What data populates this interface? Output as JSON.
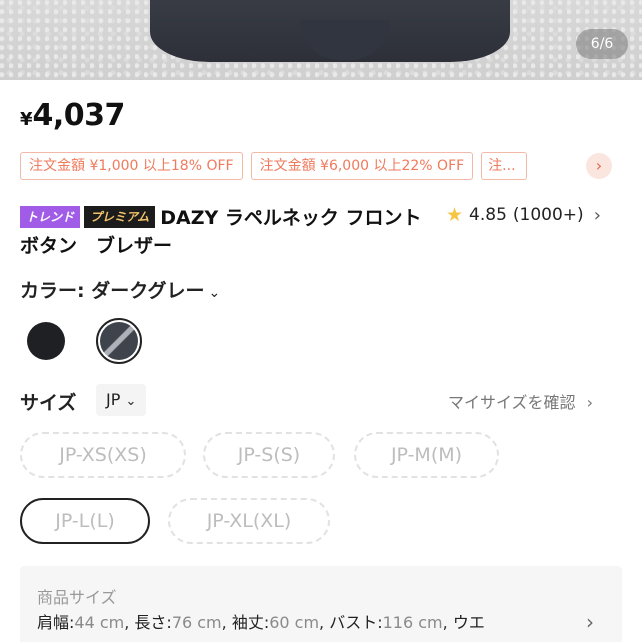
{
  "gallery": {
    "counter": "6/6"
  },
  "price": {
    "currency": "¥",
    "amount": "4,037"
  },
  "coupons": [
    "注文金額 ¥1,000 以上18% OFF",
    "注文金額 ¥6,000 以上22% OFF",
    "注..."
  ],
  "product": {
    "badge_trend": "トレンド",
    "badge_premium": "プレミアム",
    "title": "DAZY ラペルネック フロントボタン　ブレザー"
  },
  "rating": {
    "value": "4.85",
    "count": "(1000+)"
  },
  "color": {
    "label": "カラー: ダークグレー"
  },
  "size": {
    "label": "サイズ",
    "region": "JP",
    "my_size": "マイサイズを確認",
    "options": [
      "JP-XS(XS)",
      "JP-S(S)",
      "JP-M(M)",
      "JP-L(L)",
      "JP-XL(XL)"
    ]
  },
  "spec": {
    "title": "商品サイズ",
    "shoulder_k": "肩幅:",
    "shoulder_v": "44 cm",
    "length_k": "長さ:",
    "length_v": "76 cm",
    "sleeve_k": "袖丈:",
    "sleeve_v": "60 cm",
    "bust_k": "バスト:",
    "bust_v": "116 cm",
    "waist_k": "ウエ"
  },
  "colors": {
    "accent": "#f07a5c",
    "badge_trend": "#a05ce6",
    "star": "#f6c543"
  }
}
